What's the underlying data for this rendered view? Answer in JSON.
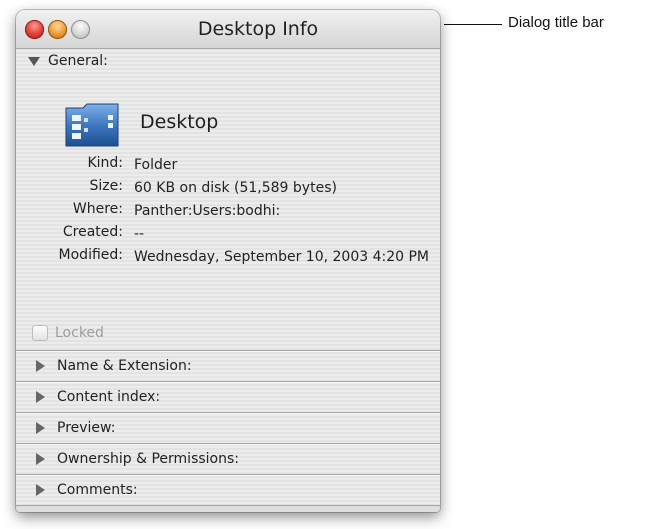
{
  "window": {
    "title": "Desktop Info"
  },
  "general": {
    "label": "General:",
    "item_name": "Desktop",
    "icon": "folder-icon",
    "rows": [
      {
        "label": "Kind:",
        "value": "Folder"
      },
      {
        "label": "Size:",
        "value": "60 KB on disk (51,589 bytes)"
      },
      {
        "label": "Where:",
        "value": "Panther:Users:bodhi:"
      },
      {
        "label": "Created:",
        "value": "--"
      },
      {
        "label": "Modified:",
        "value": "Wednesday, September 10, 2003 4:20 PM"
      }
    ],
    "locked_label": "Locked",
    "locked_checked": false
  },
  "sections": [
    {
      "label": "Name & Extension:"
    },
    {
      "label": "Content index:"
    },
    {
      "label": "Preview:"
    },
    {
      "label": "Ownership & Permissions:"
    },
    {
      "label": "Comments:"
    }
  ],
  "callout": {
    "text": "Dialog title bar"
  },
  "colors": {
    "close": "#e1453a",
    "minimize": "#f09a3a",
    "zoom": "#d4d4d4",
    "folder_blue": "#3f78c0"
  }
}
